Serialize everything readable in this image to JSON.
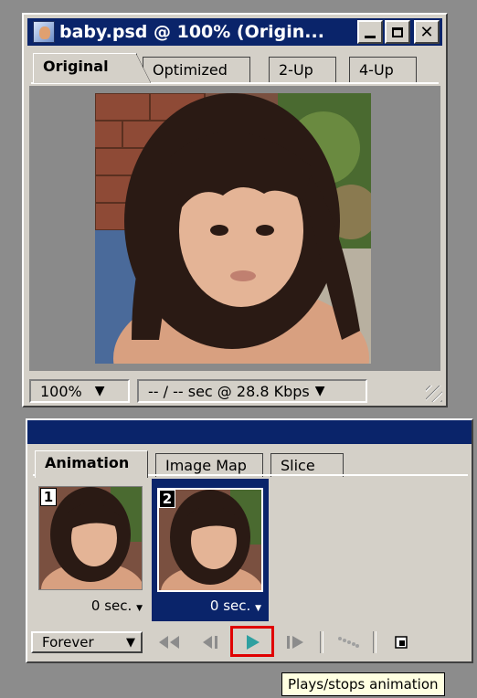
{
  "image_window": {
    "title": "baby.psd @ 100% (Origin...",
    "tabs": [
      {
        "label": "Original",
        "active": true
      },
      {
        "label": "Optimized",
        "active": false
      },
      {
        "label": "2-Up",
        "active": false
      },
      {
        "label": "4-Up",
        "active": false
      }
    ],
    "zoom": "100%",
    "download_info": "-- / -- sec @ 28.8 Kbps"
  },
  "animation_palette": {
    "tabs": [
      {
        "label": "Animation",
        "active": true
      },
      {
        "label": "Image Map",
        "active": false
      },
      {
        "label": "Slice",
        "active": false
      }
    ],
    "frames": [
      {
        "number": "1",
        "delay": "0 sec.",
        "selected": false
      },
      {
        "number": "2",
        "delay": "0 sec.",
        "selected": true
      }
    ],
    "loop": "Forever",
    "controls": {
      "first_frame_icon": "first-frame-icon",
      "prev_frame_icon": "previous-frame-icon",
      "play_icon": "play-icon",
      "next_frame_icon": "next-frame-icon",
      "tween_icon": "tween-icon",
      "new_frame_icon": "duplicate-frame-icon"
    }
  },
  "tooltip": "Plays/stops animation",
  "colors": {
    "title_bar": "#0a246a",
    "panel": "#d4d0c8",
    "play_button": "#2fa0a0",
    "highlight": "#e00000"
  }
}
